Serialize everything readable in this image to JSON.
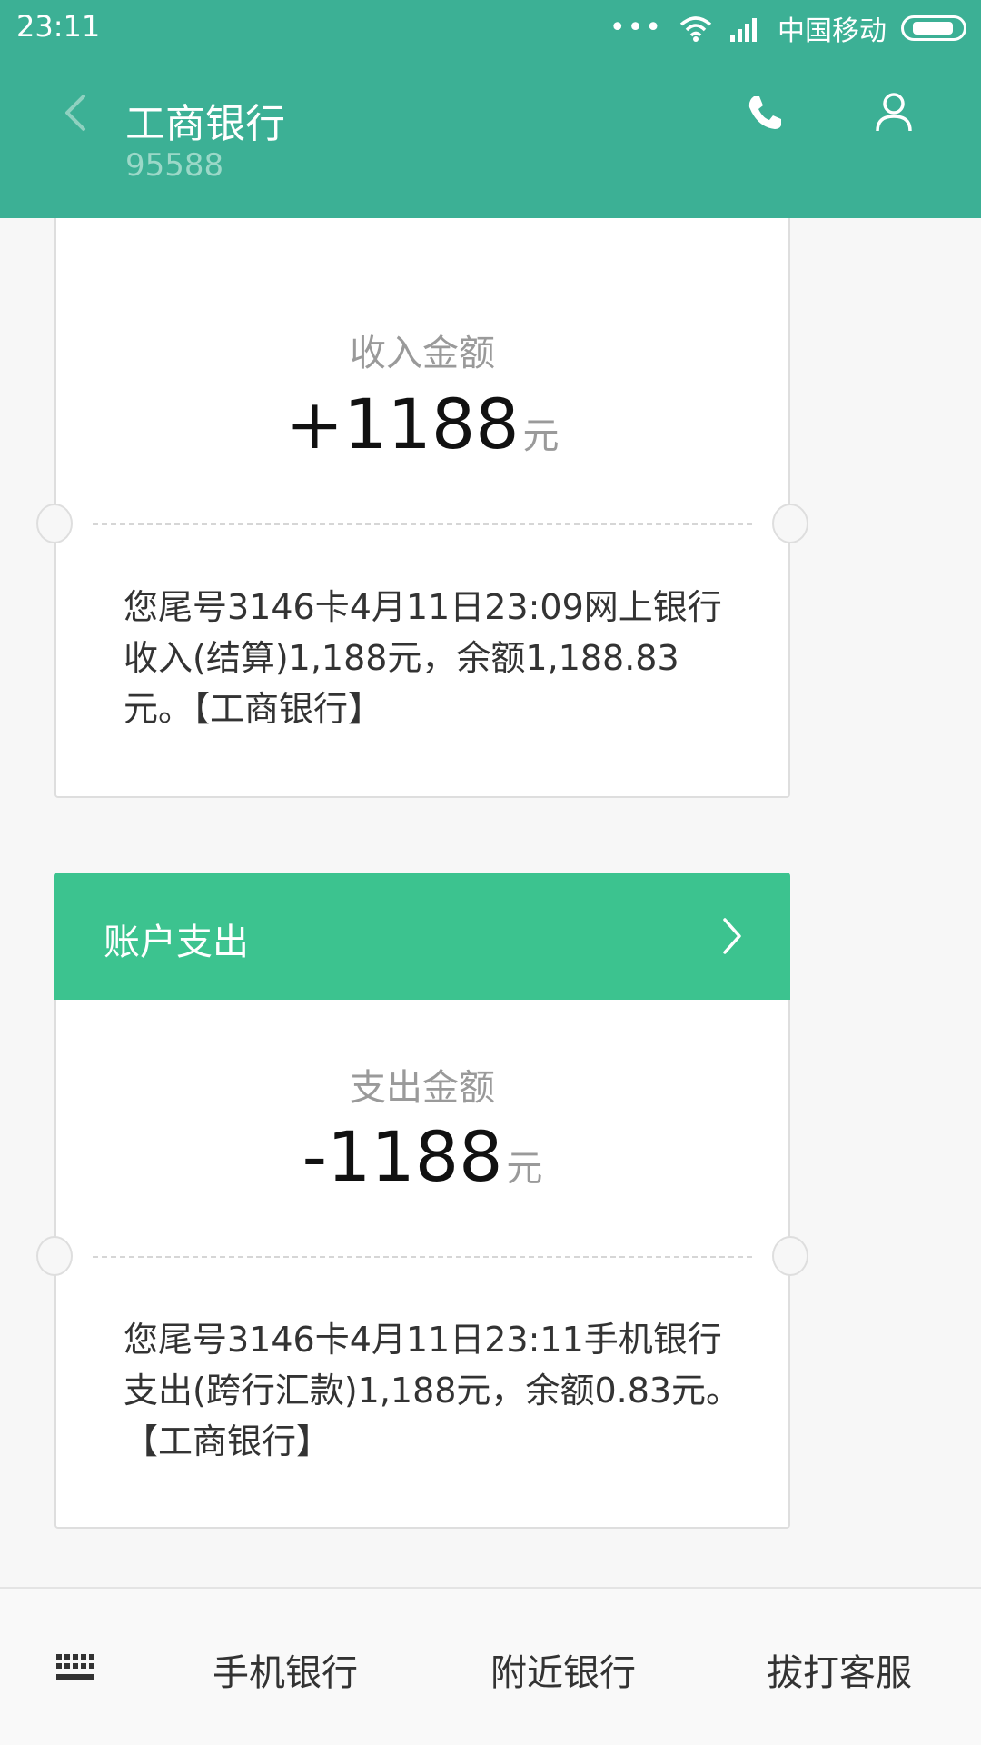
{
  "status_bar": {
    "time": "23:11",
    "dots": "•••",
    "carrier": "中国移动"
  },
  "header": {
    "title": "工商银行",
    "subtitle": "95588"
  },
  "cards": [
    {
      "amount_label": "收入金额",
      "amount_value": "+1188",
      "amount_unit": "元",
      "message": "您尾号3146卡4月11日23:09网上银行收入(结算)1,188元，余额1,188.83元。【工商银行】"
    },
    {
      "header_label": "账户支出",
      "amount_label": "支出金额",
      "amount_value": "-1188",
      "amount_unit": "元",
      "message": "您尾号3146卡4月11日23:11手机银行支出(跨行汇款)1,188元，余额0.83元。【工商银行】"
    }
  ],
  "bottom_bar": {
    "items": [
      "手机银行",
      "附近银行",
      "拔打客服"
    ]
  },
  "colors": {
    "header_bg": "#3cb095",
    "card_header_bg": "#3cc38f",
    "page_bg": "#f7f7f7"
  },
  "icons": {
    "back": "back-chevron-icon",
    "phone": "phone-icon",
    "contact": "contact-icon",
    "keyboard": "keyboard-icon",
    "chevron": "chevron-right-icon",
    "wifi": "wifi-icon",
    "signal": "signal-icon",
    "battery": "battery-icon"
  }
}
